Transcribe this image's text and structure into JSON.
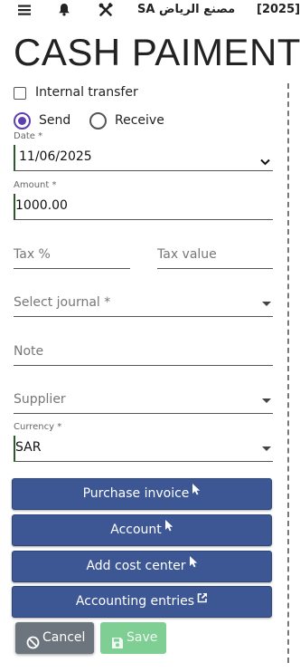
{
  "header": {
    "company": "SA مصنع الرياض",
    "year": "[2025]",
    "icons": [
      "menu-icon",
      "bell-icon",
      "tools-icon"
    ]
  },
  "page_title": "CASH PAIMENT",
  "internal_transfer": {
    "label": "Internal transfer",
    "checked": false
  },
  "direction": {
    "selected": "Send",
    "options": [
      {
        "label": "Send",
        "checked": true
      },
      {
        "label": "Receive",
        "checked": false
      }
    ]
  },
  "form": {
    "date": {
      "label": "Date *",
      "value": "11/06/2025"
    },
    "amount": {
      "label": "Amount *",
      "value": "1000.00"
    },
    "tax_percent": {
      "placeholder": "Tax %"
    },
    "tax_value": {
      "placeholder": "Tax value"
    },
    "journal": {
      "placeholder": "Select journal  *"
    },
    "note": {
      "placeholder": "Note"
    },
    "supplier": {
      "placeholder": "Supplier"
    },
    "currency": {
      "label": "Currency  *",
      "value": "SAR"
    }
  },
  "actions": {
    "purchase_invoice": "Purchase invoice",
    "account": "Account",
    "add_cost_center": "Add cost center",
    "accounting_entries": "Accounting entries",
    "cancel": "Cancel",
    "save": "Save"
  },
  "colors": {
    "primary_button": "#3c5794",
    "radio_accent": "#5e3fb0",
    "field_accent": "#2b5a28",
    "cancel_button": "#6c757d",
    "save_button": "#7fcf94"
  }
}
